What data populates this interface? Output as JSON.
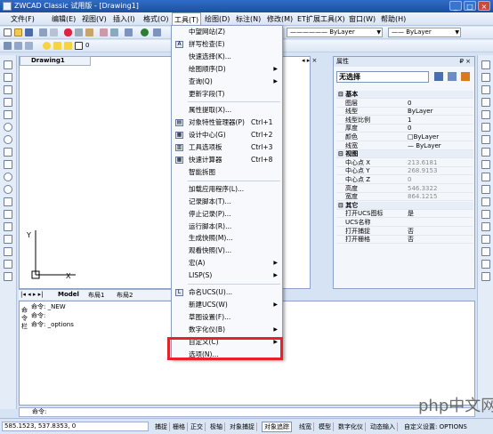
{
  "window": {
    "title": "ZWCAD Classic 试用版 - [Drawing1]",
    "min": "_",
    "max": "□",
    "close": "×"
  },
  "menu": [
    "文件(F)",
    "编辑(E)",
    "视图(V)",
    "插入(I)",
    "格式(O)",
    "工具(T)",
    "绘图(D)",
    "标注(N)",
    "修改(M)",
    "ET扩展工具(X)",
    "窗口(W)",
    "帮助(H)"
  ],
  "toolbar": {
    "layer_combo": "ByLayer",
    "layer_combo2": "ByLayer",
    "color_value": "0"
  },
  "drawing_tab": "Drawing1",
  "layout_tabs": [
    "Model",
    "布局1",
    "布局2"
  ],
  "properties": {
    "header": "属性",
    "pin": "₽ ×",
    "selection": "无选择",
    "rows": [
      {
        "k": "基本",
        "v": "",
        "sec": true
      },
      {
        "k": "图层",
        "v": "0"
      },
      {
        "k": "线型",
        "v": "ByLayer"
      },
      {
        "k": "线型比例",
        "v": "1"
      },
      {
        "k": "厚度",
        "v": "0"
      },
      {
        "k": "颜色",
        "v": "□ByLayer"
      },
      {
        "k": "线宽",
        "v": "— ByLayer"
      },
      {
        "k": "视图",
        "v": "",
        "sec": true
      },
      {
        "k": "中心点 X",
        "v": "213.6181",
        "grey": true
      },
      {
        "k": "中心点 Y",
        "v": "268.9153",
        "grey": true
      },
      {
        "k": "中心点 Z",
        "v": "0",
        "grey": true
      },
      {
        "k": "高度",
        "v": "546.3322",
        "grey": true
      },
      {
        "k": "宽度",
        "v": "864.1215",
        "grey": true
      },
      {
        "k": "其它",
        "v": "",
        "sec": true
      },
      {
        "k": "打开UCS图标",
        "v": "是"
      },
      {
        "k": "UCS名称",
        "v": ""
      },
      {
        "k": "打开捕捉",
        "v": "否"
      },
      {
        "k": "打开栅格",
        "v": "否"
      }
    ]
  },
  "command": {
    "side_label": "命令栏",
    "lines": [
      "命令: _NEW",
      "命令:",
      "命令: _options"
    ],
    "prompt": "命令:"
  },
  "status": {
    "coords": "585.1523, 537.8353, 0",
    "buttons": [
      "捕捉",
      "栅格",
      "正交",
      "极轴",
      "对象捕捉",
      "对象追踪",
      "线宽",
      "模型",
      "数字化仪",
      "动态输入",
      "自定义设置: OPTIONS"
    ]
  },
  "axis": {
    "y": "Y",
    "x": "X"
  },
  "dropdown": [
    {
      "label": "中望网站(Z)",
      "icon": ""
    },
    {
      "label": "拼写检查(E)",
      "icon": "A"
    },
    {
      "label": "快速选择(K)...",
      "icon": ""
    },
    {
      "label": "绘图顺序(D)",
      "icon": "",
      "sub": true
    },
    {
      "label": "查询(Q)",
      "icon": "",
      "sub": true
    },
    {
      "label": "更新字段(T)",
      "icon": ""
    },
    {
      "sep": true
    },
    {
      "label": "属性提取(X)...",
      "icon": ""
    },
    {
      "label": "对象特性管理器(P)",
      "sc": "Ctrl+1",
      "icon": "▤"
    },
    {
      "label": "设计中心(G)",
      "sc": "Ctrl+2",
      "icon": "▦"
    },
    {
      "label": "工具选项板",
      "sc": "Ctrl+3",
      "icon": "▥"
    },
    {
      "label": "快速计算器",
      "sc": "Ctrl+8",
      "icon": "▦"
    },
    {
      "label": "智能拆图",
      "icon": ""
    },
    {
      "sep": true
    },
    {
      "label": "加载应用程序(L)...",
      "icon": ""
    },
    {
      "label": "记录脚本(T)...",
      "icon": ""
    },
    {
      "label": "停止记录(P)...",
      "icon": ""
    },
    {
      "label": "运行脚本(R)...",
      "icon": ""
    },
    {
      "label": "生成快照(M)...",
      "icon": ""
    },
    {
      "label": "观看快照(V)...",
      "icon": ""
    },
    {
      "label": "宏(A)",
      "icon": "",
      "sub": true
    },
    {
      "label": "LISP(S)",
      "icon": "",
      "sub": true
    },
    {
      "sep": true
    },
    {
      "label": "命名UCS(U)...",
      "icon": "L"
    },
    {
      "label": "新建UCS(W)",
      "icon": "",
      "sub": true
    },
    {
      "label": "草图设置(F)...",
      "icon": ""
    },
    {
      "label": "数字化仪(B)",
      "icon": "",
      "sub": true
    },
    {
      "label": "自定义(C)",
      "icon": "",
      "sub": true
    },
    {
      "label": "选项(N)...",
      "icon": ""
    }
  ],
  "watermark": "php中文网",
  "colors": {
    "accent": "#2f6cc8",
    "highlight": "#e52229"
  }
}
